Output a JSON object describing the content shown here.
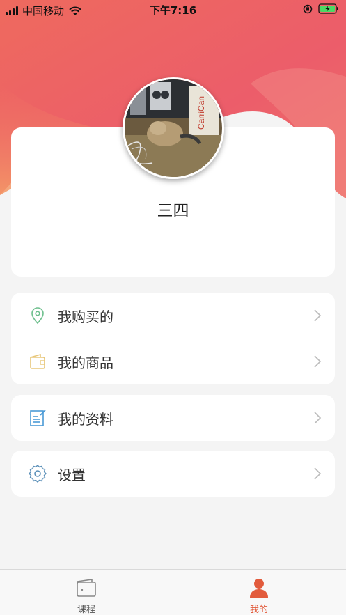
{
  "status_bar": {
    "carrier": "中国移动",
    "time": "下午7:16"
  },
  "profile": {
    "username": "三四",
    "avatar_icon": "user-avatar-photo"
  },
  "menu": {
    "group1": [
      {
        "label": "我购买的",
        "icon": "location-pin-icon",
        "icon_color": "#6dbf8d"
      },
      {
        "label": "我的商品",
        "icon": "wallet-icon",
        "icon_color": "#e8c77a"
      }
    ],
    "group2": [
      {
        "label": "我的资料",
        "icon": "edit-document-icon",
        "icon_color": "#4a9ad6"
      }
    ],
    "group3": [
      {
        "label": "设置",
        "icon": "gear-icon",
        "icon_color": "#5a8fb8"
      }
    ]
  },
  "tab_bar": {
    "tabs": [
      {
        "label": "课程",
        "icon": "course-card-icon",
        "active": false
      },
      {
        "label": "我的",
        "icon": "person-icon",
        "active": true
      }
    ]
  },
  "colors": {
    "accent": "#e25b3c",
    "header_gradient_top": "#ea5a6b",
    "header_gradient_bottom": "#f3845f"
  }
}
